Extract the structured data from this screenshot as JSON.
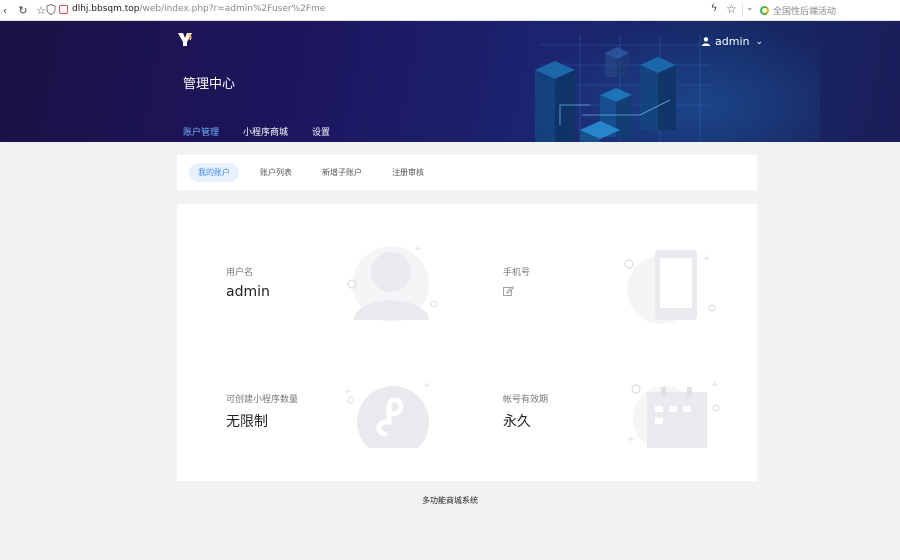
{
  "browser": {
    "url_host": "dlhj.bbsqm.top",
    "url_path": "/web/index.php?r=admin%2Fuser%2Fme",
    "search_text": "全国性后端活动"
  },
  "header": {
    "username": "admin",
    "title": "管理中心",
    "tabs": [
      {
        "label": "账户管理",
        "active": true
      },
      {
        "label": "小程序商城",
        "active": false
      },
      {
        "label": "设置",
        "active": false
      }
    ]
  },
  "subnav": {
    "items": [
      {
        "label": "我的账户",
        "active": true
      },
      {
        "label": "账户列表",
        "active": false
      },
      {
        "label": "新增子账户",
        "active": false
      },
      {
        "label": "注册审核",
        "active": false
      }
    ]
  },
  "account": {
    "username_label": "用户名",
    "username_value": "admin",
    "phone_label": "手机号",
    "miniapp_label": "可创建小程序数量",
    "miniapp_value": "无限制",
    "expiry_label": "帐号有效期",
    "expiry_value": "永久"
  },
  "footer": {
    "text": "多功能商城系统"
  },
  "colors": {
    "accent": "#3d8cf0",
    "banner_dark": "#1a1245"
  }
}
